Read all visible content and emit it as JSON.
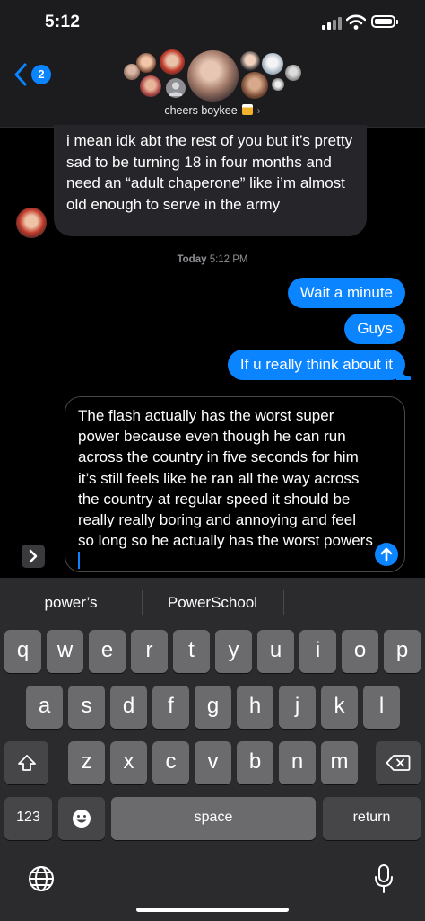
{
  "status_bar": {
    "time": "5:12"
  },
  "header": {
    "unread_count": "2",
    "group_name": "cheers boykee"
  },
  "messages": {
    "incoming": {
      "text": "i mean idk abt the rest of you but it’s pretty sad to be turning 18 in four months and need an “adult chaperone” like i’m almost old enough to serve in the army"
    },
    "timestamp": {
      "day": "Today",
      "time": "5:12 PM"
    },
    "outgoing": [
      "Wait a minute",
      "Guys",
      "If u really think about it"
    ]
  },
  "compose": {
    "text": "The flash actually has the worst super power because even though he can run across the country in five seconds for him it’s still feels like he ran all the way across the country at regular speed it should be really really boring and annoying and feel so long so he actually has the worst powers"
  },
  "keyboard": {
    "suggestions": [
      "power’s",
      "PowerSchool",
      ""
    ],
    "row1": [
      "q",
      "w",
      "e",
      "r",
      "t",
      "y",
      "u",
      "i",
      "o",
      "p"
    ],
    "row2": [
      "a",
      "s",
      "d",
      "f",
      "g",
      "h",
      "j",
      "k",
      "l"
    ],
    "row3": [
      "z",
      "x",
      "c",
      "v",
      "b",
      "n",
      "m"
    ],
    "numbers_label": "123",
    "space_label": "space",
    "return_label": "return"
  },
  "colors": {
    "accent": "#0a84ff",
    "incoming_bubble": "#26252a",
    "keyboard_bg": "#2b2b2d",
    "key": "#6b6b6e",
    "key_dark": "#464648"
  },
  "icons": [
    "back-chevron-icon",
    "wifi-icon",
    "battery-icon",
    "beer-icon",
    "apps-chevron-icon",
    "send-arrow-icon",
    "shift-icon",
    "delete-icon",
    "emoji-icon",
    "globe-icon",
    "microphone-icon"
  ]
}
